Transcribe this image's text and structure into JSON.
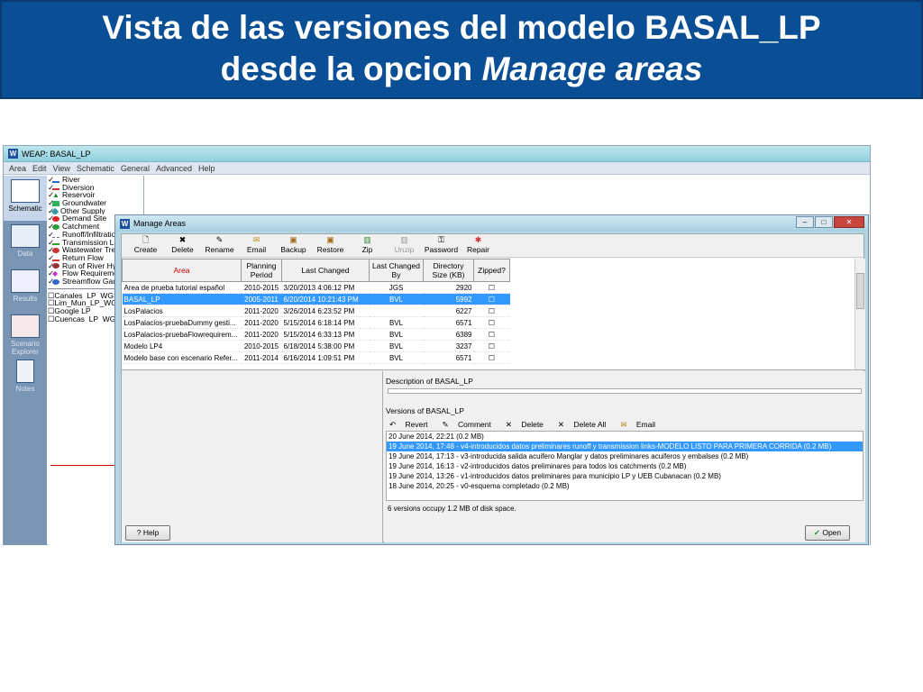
{
  "slide": {
    "title_line1": "Vista de las versiones del modelo BASAL_LP",
    "title_line2_prefix": "desde la opcion ",
    "title_line2_emph": "Manage areas"
  },
  "weap": {
    "title": "WEAP: BASAL_LP",
    "menu": [
      "Area",
      "Edit",
      "View",
      "Schematic",
      "General",
      "Advanced",
      "Help"
    ],
    "views": [
      {
        "label": "Schematic",
        "icon": "schematic-icon"
      },
      {
        "label": "Data",
        "icon": "data-icon"
      },
      {
        "label": "Results",
        "icon": "results-icon"
      },
      {
        "label": "Scenario Explorer",
        "icon": "scenario-explorer-icon"
      },
      {
        "label": "Notes",
        "icon": "notes-icon"
      }
    ],
    "legend": [
      "River",
      "Diversion",
      "Reservoir",
      "Groundwater",
      "Other Supply",
      "Demand Site",
      "Catchment",
      "Runoff/Infiltration",
      "Transmission Link",
      "Wastewater Treatment",
      "Return Flow",
      "Run of River Hydro",
      "Flow Requirement",
      "Streamflow Gauge"
    ],
    "layers": [
      "Canales_LP_WGS",
      "Lim_Mun_LP_WGS",
      "Google LP",
      "Cuencas_LP_WGS"
    ]
  },
  "dialog": {
    "title": "Manage Areas",
    "toolbar": [
      "Create",
      "Delete",
      "Rename",
      "Email",
      "Backup",
      "Restore",
      "Zip",
      "Unzip",
      "Password",
      "Repair"
    ],
    "columns": [
      "Area",
      "Planning Period",
      "Last Changed",
      "Last Changed By",
      "Directory Size (KB)",
      "Zipped?"
    ],
    "rows": [
      [
        "Area de prueba tutorial español",
        "2010-2015",
        "3/20/2013 4:06:12 PM",
        "JGS",
        "2920"
      ],
      [
        "BASAL_LP",
        "2005-2011",
        "6/20/2014 10:21:43 PM",
        "BVL",
        "5992"
      ],
      [
        "LosPalacios",
        "2011-2020",
        "3/26/2014 6:23:52 PM",
        "",
        "6227"
      ],
      [
        "LosPalacios-pruebaDummy gesti...",
        "2011-2020",
        "5/15/2014 6:18:14 PM",
        "BVL",
        "6571"
      ],
      [
        "LosPalacios-pruebaFlowrequirem...",
        "2011-2020",
        "5/15/2014 6:33:13 PM",
        "BVL",
        "6389"
      ],
      [
        "Modelo LP4",
        "2010-2015",
        "6/18/2014 5:38:00 PM",
        "BVL",
        "3237"
      ],
      [
        "Modelo base con escenario Refer...",
        "2011-2014",
        "6/16/2014 1:09:51 PM",
        "BVL",
        "6571"
      ]
    ],
    "selected_row": 1,
    "description_label": "Description of BASAL_LP",
    "versions_label": "Versions of BASAL_LP",
    "version_actions": [
      "Revert",
      "Comment",
      "Delete",
      "Delete All",
      "Email"
    ],
    "versions": [
      "20 June 2014, 22:21  (0.2 MB)",
      "19 June 2014, 17:48 - v4-introducidos datos preliminares runoff y transmission links-MODELO LISTO PARA PRIMERA CORRIDA  (0.2 MB)",
      "19 June 2014, 17:13 - v3-introducida salida acuifero Manglar y datos preliminares acuiferos y embalses  (0.2 MB)",
      "19 June 2014, 16:13 - v2-introducidos datos preliminares para todos los catchments  (0.2 MB)",
      "19 June 2014, 13:26 - v1-introducidos datos preliminares para municipio LP y UEB Cubanacan  (0.2 MB)",
      "18 June 2014, 20:25 - v0-esquema completado  (0.2 MB)"
    ],
    "selected_version": 1,
    "versions_status": "6 versions occupy 1.2 MB of disk space.",
    "help": "Help",
    "open": "Open"
  }
}
